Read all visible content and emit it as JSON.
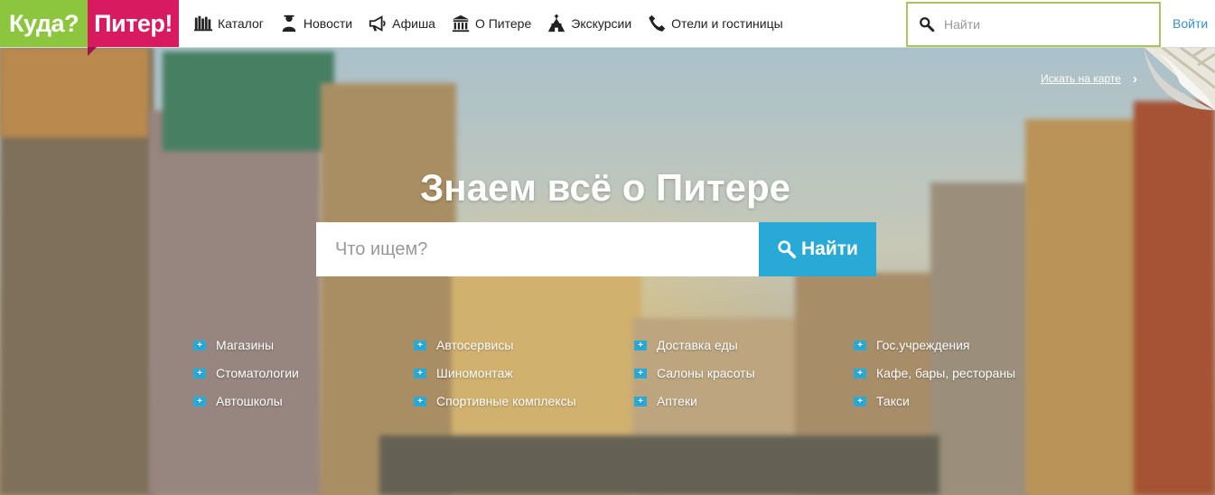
{
  "logo": {
    "part1": "Куда?",
    "part2": "Питер!"
  },
  "nav": [
    {
      "label": "Каталог",
      "icon": "catalog-icon"
    },
    {
      "label": "Новости",
      "icon": "news-icon"
    },
    {
      "label": "Афиша",
      "icon": "megaphone-icon"
    },
    {
      "label": "О Питере",
      "icon": "museum-icon"
    },
    {
      "label": "Экскурсии",
      "icon": "church-icon"
    },
    {
      "label": "Отели и гостиницы",
      "icon": "phone-icon"
    }
  ],
  "header_search": {
    "placeholder": "Найти",
    "button_label": "Войти"
  },
  "hero": {
    "map_link": "Искать на карте",
    "title": "Знаем всё о Питере",
    "search_placeholder": "Что ищем?",
    "search_button": "Найти"
  },
  "categories": [
    [
      "Магазины",
      "Стоматологии",
      "Автошколы"
    ],
    [
      "Автосервисы",
      "Шиномонтаж",
      "Спортивные комплексы"
    ],
    [
      "Доставка еды",
      "Салоны красоты",
      "Аптеки"
    ],
    [
      "Гос.учреждения",
      "Кафе, бары, рестораны",
      "Такси"
    ]
  ],
  "colors": {
    "green": "#8cc63f",
    "magenta": "#d81b60",
    "accent": "#29a9d6",
    "search_border": "#a5c65a"
  }
}
